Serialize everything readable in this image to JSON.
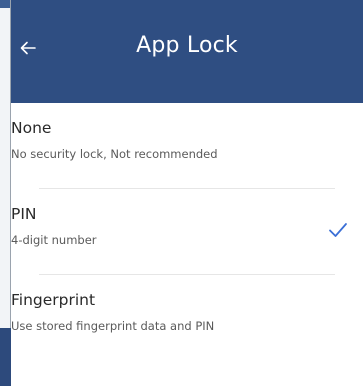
{
  "header": {
    "title": "App Lock",
    "back_icon": "back-arrow-icon"
  },
  "options": [
    {
      "label": "None",
      "description": "No security lock, Not recommended",
      "selected": false
    },
    {
      "label": "PIN",
      "description": "4-digit number",
      "selected": true
    },
    {
      "label": "Fingerprint",
      "description": "Use stored fingerprint data and PIN",
      "selected": false
    }
  ],
  "colors": {
    "appbar": "#2f4e82",
    "accent": "#3b6fd6"
  }
}
